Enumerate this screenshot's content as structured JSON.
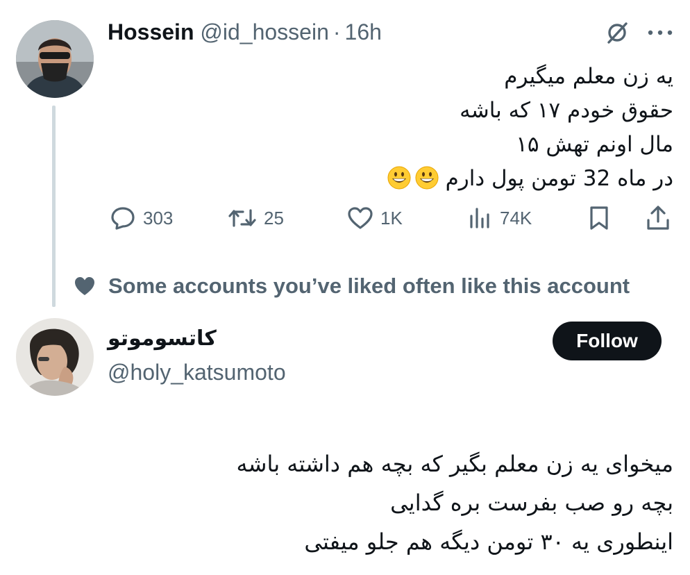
{
  "tweet": {
    "author_name": "Hossein",
    "author_handle": "@id_hossein",
    "separator": "·",
    "time": "16h",
    "body_lines": [
      "یه زن معلم میگیرم",
      "حقوق خودم ۱۷ که باشه",
      "مال اونم تهش ۱۵",
      "در ماه 32 تومن پول دارم"
    ],
    "emojis": [
      "grinning-face",
      "grinning-face"
    ],
    "actions": {
      "replies": "303",
      "retweets": "25",
      "likes": "1K",
      "views": "74K"
    },
    "icons": [
      "grok-icon",
      "more-icon",
      "reply-icon",
      "retweet-icon",
      "like-icon",
      "views-icon",
      "bookmark-icon",
      "share-icon"
    ]
  },
  "social_context": {
    "text": "Some accounts you’ve liked often like this account",
    "icon": "heart-icon"
  },
  "suggested": {
    "name": "کاتسوموتو",
    "handle": "@holy_katsumoto",
    "follow_label": "Follow",
    "body_lines": [
      "میخوای یه زن معلم بگیر که بچه هم داشته باشه",
      "بچه رو صب بفرست بره گدایی",
      "اینطوری یه ۳۰ تومن دیگه هم جلو میفتی"
    ]
  },
  "colors": {
    "text": "#0f1419",
    "muted": "#536471",
    "thread_line": "#cfd9de",
    "button_bg": "#0f1419",
    "emoji_yellow": "#ffcc33"
  }
}
